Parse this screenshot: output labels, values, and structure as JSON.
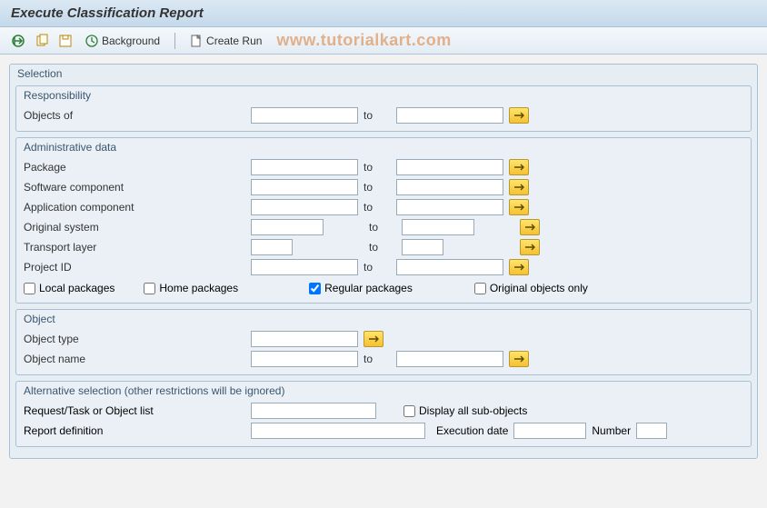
{
  "title": "Execute Classification Report",
  "toolbar": {
    "background": "Background",
    "create_run": "Create Run",
    "watermark": "www.tutorialkart.com"
  },
  "outer": {
    "title": "Selection"
  },
  "resp": {
    "title": "Responsibility",
    "objects_of": "Objects of",
    "to": "to"
  },
  "admin": {
    "title": "Administrative data",
    "package": "Package",
    "softcomp": "Software component",
    "appcomp": "Application component",
    "origsys": "Original system",
    "tlayer": "Transport layer",
    "projid": "Project ID",
    "to": "to",
    "local": "Local packages",
    "home": "Home packages",
    "regular": "Regular packages",
    "origonly": "Original objects only"
  },
  "object": {
    "title": "Object",
    "type": "Object type",
    "name": "Object name",
    "to": "to"
  },
  "alt": {
    "title": "Alternative selection (other restrictions will be ignored)",
    "req": "Request/Task or Object list",
    "dispsub": "Display all sub-objects",
    "repdef": "Report definition",
    "execdate": "Execution date",
    "number": "Number"
  }
}
